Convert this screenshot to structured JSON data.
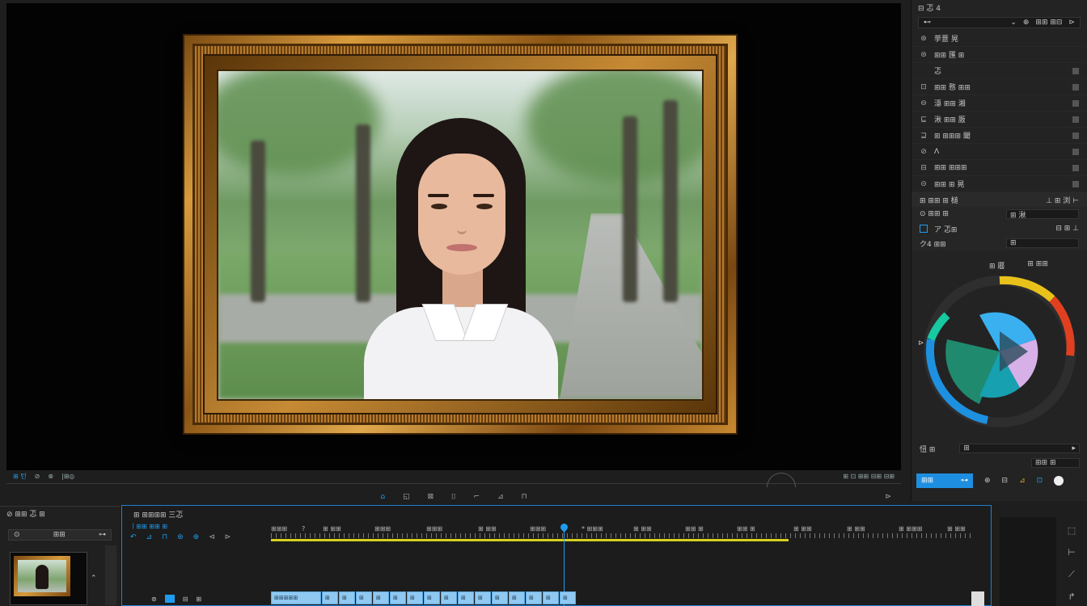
{
  "preview": {
    "toolbar_left": [
      "⊞ 턴",
      "⊘",
      "⊗",
      "|⊞◎"
    ],
    "toolbar_right": "⊞ ⊡ ⊞⊞ ⊟⊞ ⊟⊞",
    "transport": [
      "⌂",
      "◱",
      "⊠",
      "⌷",
      "⌐",
      "⊿",
      "⊓"
    ],
    "transport_right": "⊳"
  },
  "right_panel": {
    "top_label": "⊟ 忑 4",
    "dropdown_left": "⊷",
    "dropdown_right": [
      "⊕",
      "⊞⊞ ⊞⊟",
      "⊳"
    ],
    "rows": [
      {
        "icon": "⊛",
        "label": "荢薏 晃"
      },
      {
        "icon": "⊜",
        "label": "⊞⊞ 匯 ⊞"
      },
      {
        "icon": "",
        "label": "忑"
      },
      {
        "icon": "⊡",
        "label": "⊞⊞ 憝 ⊞⊞"
      },
      {
        "icon": "⊖",
        "label": "濦 ⊞⊞ 湘"
      },
      {
        "icon": "⊑",
        "label": "湫 ⊞⊞ 厫"
      },
      {
        "icon": "⊒",
        "label": "⊞ ⊞⊞⊞ 閾"
      },
      {
        "icon": "⊘",
        "label": "ⴷ"
      },
      {
        "icon": "⊟",
        "label": "⊞⊞ ⊞⊞⊞"
      },
      {
        "icon": "⊝",
        "label": "⊞⊞ ⊞ 晃"
      }
    ],
    "section_label": "⊞ ⊞⊞ ⊞ 槌",
    "section_right": "⊥ ⊞ 浏 ⊢",
    "sub_rows": [
      {
        "label": "⊙ ⊞⊞ ⊞",
        "field": "⊞ 湫"
      },
      {
        "label": "ア  忑⊞",
        "field": "⊟ ⊞ ⊥"
      },
      {
        "label": "ク4  ⊞⊞",
        "field": "⊞"
      }
    ],
    "wheel_labels": [
      "⊞ 厬",
      "⊞ ⊞⊞"
    ],
    "bottom_label": "忸 ⊞",
    "bottom_field": "⊞",
    "bottom_small": "⊞⊞ ⊞",
    "tab_primary": "⊞⊞",
    "tabs": [
      "⊕",
      "⊟",
      "⊿",
      "⊡"
    ]
  },
  "project": {
    "title": "⊘ ⊞⊞ 忑 ⊞",
    "field_left": "⊙",
    "field_center": "⊞⊞",
    "field_right": "⊶"
  },
  "timeline": {
    "title": "⊞ ⊞⊞⊞⊞ 三忑",
    "timecode": "ㅣ⊞⊞ ⊞⊞ ⊞",
    "tools": [
      "↶",
      "⊿",
      "⊓",
      "⊛",
      "⊕",
      "⊲",
      "⊳"
    ],
    "ruler_labels": [
      "⊞⊞⊞",
      "?",
      "⊞ ⊞⊞",
      "⊞⊞⊞",
      "⊞⊞⊞",
      "⊞ ⊞⊞",
      "⊞⊞⊞",
      "* ⊞⊞⊞",
      "⊞ ⊞⊞",
      "⊞⊞ ⊞",
      "⊞⊞ ⊞",
      "⊞ ⊞⊞",
      "⊞ ⊞⊞",
      "⊞ ⊞⊞⊞",
      "⊞ ⊞⊞"
    ],
    "track_labels": [
      "⊚",
      "⊟",
      "⊞"
    ],
    "clips": [
      "⊞⊞⊞⊞⊞",
      "⊞",
      "⊞",
      "⊞",
      "⊞",
      "⊞",
      "⊞",
      "⊞",
      "⊞",
      "⊞",
      "⊞",
      "⊞",
      "⊞",
      "⊞",
      "⊞",
      "⊞"
    ]
  },
  "colors": {
    "accent": "#1e9cf0",
    "work_area": "#d6d01e",
    "frame_gold": "#d79a3c"
  }
}
